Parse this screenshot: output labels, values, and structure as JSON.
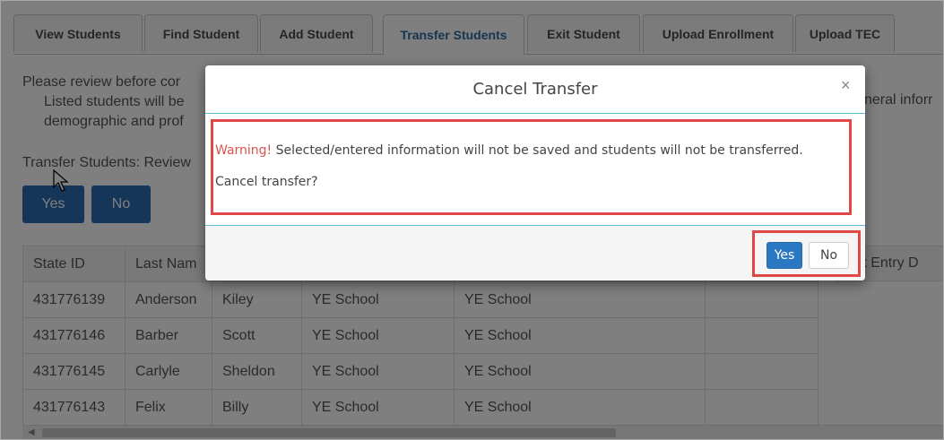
{
  "tabs": [
    {
      "label": "View Students"
    },
    {
      "label": "Find Student"
    },
    {
      "label": "Add Student"
    },
    {
      "label": "Transfer Students",
      "active": true
    },
    {
      "label": "Exit Student"
    },
    {
      "label": "Upload Enrollment"
    },
    {
      "label": "Upload TEC"
    }
  ],
  "background": {
    "intro_line1": "Please review before cor",
    "intro_line2": "Listed students will be",
    "intro_line3": "demographic and prof",
    "intro_right": "neral inforr",
    "review_label": "Transfer Students: Review",
    "yes_label": "Yes",
    "no_label": "No"
  },
  "table": {
    "headers": [
      "State ID",
      "Last Nam",
      "",
      "",
      "",
      "",
      "trict Entry D"
    ],
    "rows": [
      [
        "431776139",
        "Anderson",
        "Kiley",
        "YE School",
        "YE School",
        ""
      ],
      [
        "431776146",
        "Barber",
        "Scott",
        "YE School",
        "YE School",
        ""
      ],
      [
        "431776145",
        "Carlyle",
        "Sheldon",
        "YE School",
        "YE School",
        ""
      ],
      [
        "431776143",
        "Felix",
        "Billy",
        "YE School",
        "YE School",
        ""
      ]
    ]
  },
  "modal": {
    "title": "Cancel Transfer",
    "close_symbol": "×",
    "warning_word": "Warning!",
    "warning_text": " Selected/entered information will not be saved and students will not be transferred.",
    "question": "Cancel transfer?",
    "yes_label": "Yes",
    "no_label": "No"
  },
  "colors": {
    "primary": "#2b78c2",
    "warning": "#d9534f",
    "highlight": "#e04848",
    "divider": "#5bc0de"
  }
}
